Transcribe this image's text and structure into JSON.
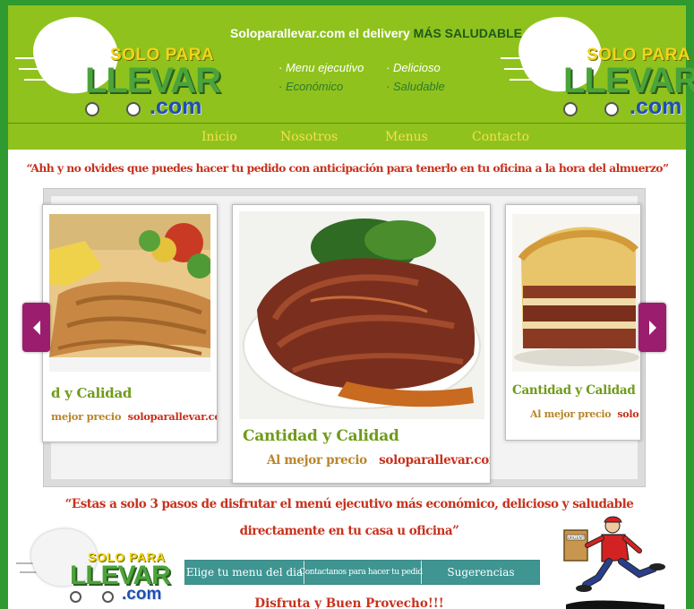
{
  "brand": {
    "solo": "SOLO PARA",
    "llevar": "LLEVAR",
    "com": ".com"
  },
  "header": {
    "tagline_main": "Soloparallevar.com el delivery",
    "tagline_accent": "MÁS SALUDABLE",
    "features": [
      {
        "text": "· Menu ejecutivo",
        "color": "#ffffff"
      },
      {
        "text": "· Delicioso",
        "color": "#ffffff"
      },
      {
        "text": "· Económico",
        "color": "#2f7a2f"
      },
      {
        "text": "· Saludable",
        "color": "#2f7a2f"
      }
    ]
  },
  "nav": {
    "items": [
      "Inicio",
      "Nosotros",
      "Menus",
      "Contacto"
    ]
  },
  "quote_top": "“Ahh y no olvides que puedes hacer tu pedido con anticipación para tenerlo en tu oficina a la hora del almuerzo”",
  "carousel": {
    "slides": [
      {
        "caption1": "d y Calidad",
        "caption2_label": "mejor precio",
        "caption2_site": "soloparallevar.com"
      },
      {
        "caption1": "Cantidad y Calidad",
        "caption2_label": "Al mejor precio",
        "caption2_site": "soloparallevar.com"
      },
      {
        "caption1": "Cantidad y Calidad",
        "caption2_label": "Al mejor precio",
        "caption2_site": "solo"
      }
    ]
  },
  "quote_bottom": {
    "line1": "“Estas a solo 3 pasos de disfrutar el menú ejecutivo más económico, delicioso y saludable",
    "line2": "directamente en tu casa u oficina”"
  },
  "steps": {
    "step1": "Elige tu menu  del dia",
    "step2": "Contactanos para hacer tu pedido",
    "step3": "Sugerencias"
  },
  "footer_text": "Disfruta y Buen Provecho!!!",
  "courier_box_label": "URGENT",
  "colors": {
    "frame": "#2f9a2f",
    "header_bg": "#8fc21d",
    "quote_red": "#c8311c",
    "arrow": "#9b1d6e",
    "steps_bg": "#3e9592"
  }
}
